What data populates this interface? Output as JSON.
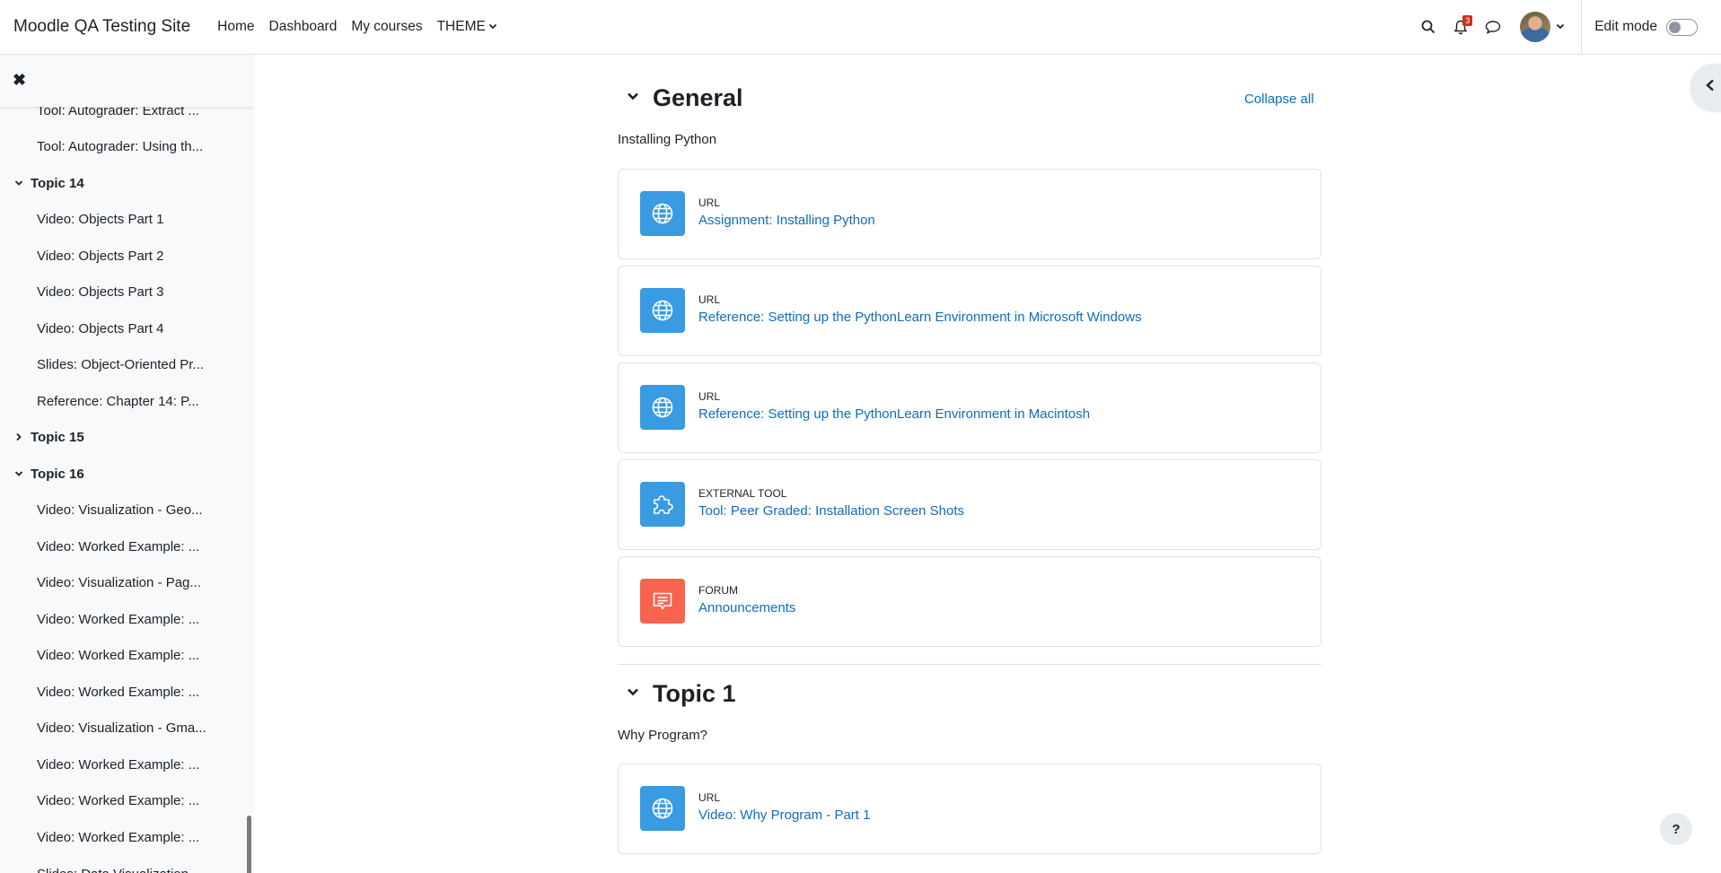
{
  "navbar": {
    "site_name": "Moodle QA Testing Site",
    "links": [
      "Home",
      "Dashboard",
      "My courses",
      "THEME"
    ],
    "notification_count": "3",
    "edit_mode_label": "Edit mode"
  },
  "drawer": {
    "items": [
      {
        "kind": "item",
        "label": "Tool: Autograder: Extract ..."
      },
      {
        "kind": "item",
        "label": "Tool: Autograder: Using th..."
      },
      {
        "kind": "section",
        "label": "Topic 14",
        "expanded": true
      },
      {
        "kind": "item",
        "label": "Video: Objects Part 1"
      },
      {
        "kind": "item",
        "label": "Video: Objects Part 2"
      },
      {
        "kind": "item",
        "label": "Video: Objects Part 3"
      },
      {
        "kind": "item",
        "label": "Video: Objects Part 4"
      },
      {
        "kind": "item",
        "label": "Slides: Object-Oriented Pr..."
      },
      {
        "kind": "item",
        "label": "Reference: Chapter 14: P..."
      },
      {
        "kind": "section",
        "label": "Topic 15",
        "expanded": false
      },
      {
        "kind": "section",
        "label": "Topic 16",
        "expanded": true
      },
      {
        "kind": "item",
        "label": "Video: Visualization - Geo..."
      },
      {
        "kind": "item",
        "label": "Video: Worked Example: ..."
      },
      {
        "kind": "item",
        "label": "Video: Visualization - Pag..."
      },
      {
        "kind": "item",
        "label": "Video: Worked Example: ..."
      },
      {
        "kind": "item",
        "label": "Video: Worked Example: ..."
      },
      {
        "kind": "item",
        "label": "Video: Worked Example: ..."
      },
      {
        "kind": "item",
        "label": "Video: Visualization - Gma..."
      },
      {
        "kind": "item",
        "label": "Video: Worked Example: ..."
      },
      {
        "kind": "item",
        "label": "Video: Worked Example: ..."
      },
      {
        "kind": "item",
        "label": "Video: Worked Example: ..."
      },
      {
        "kind": "item",
        "label": "Slides: Data Visualization"
      }
    ]
  },
  "main": {
    "collapse_all": "Collapse all",
    "sections": [
      {
        "title": "General",
        "summary": "Installing Python",
        "activities": [
          {
            "type": "URL",
            "name": "Assignment: Installing Python",
            "icon": "globe-icon",
            "color": "#399be2"
          },
          {
            "type": "URL",
            "name": "Reference: Setting up the PythonLearn Environment in Microsoft Windows",
            "icon": "globe-icon",
            "color": "#399be2"
          },
          {
            "type": "URL",
            "name": "Reference: Setting up the PythonLearn Environment in Macintosh",
            "icon": "globe-icon",
            "color": "#399be2"
          },
          {
            "type": "External tool",
            "name": "Tool: Peer Graded: Installation Screen Shots",
            "icon": "puzzle-icon",
            "color": "#399be2"
          },
          {
            "type": "Forum",
            "name": "Announcements",
            "icon": "forum-icon",
            "color": "#f7634d"
          }
        ]
      },
      {
        "title": "Topic 1",
        "summary": "Why Program?",
        "activities": [
          {
            "type": "URL",
            "name": "Video: Why Program - Part 1",
            "icon": "globe-icon",
            "color": "#399be2"
          }
        ]
      }
    ]
  },
  "help_label": "?"
}
